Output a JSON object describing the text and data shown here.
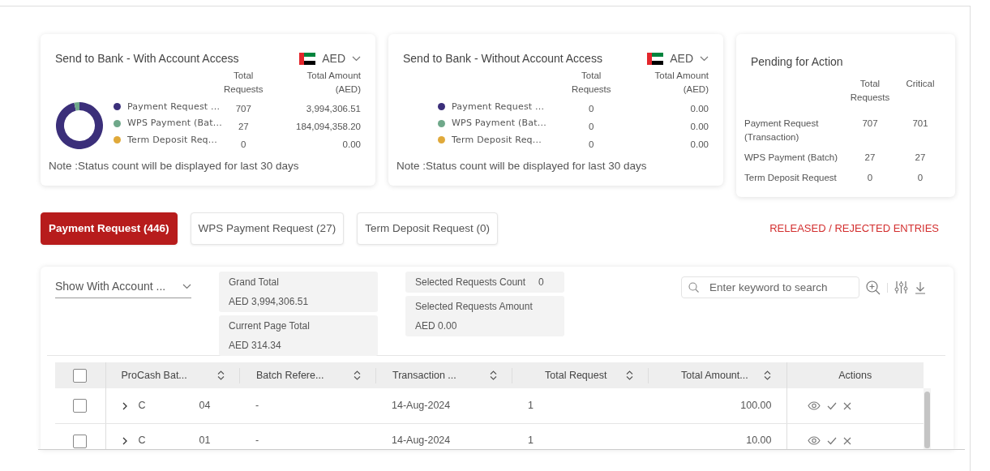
{
  "summary_cards": [
    {
      "title": "Send to Bank - With Account Access",
      "currency": "AED",
      "columns": [
        "Total Requests",
        "Total Amount (AED)"
      ],
      "rows": [
        {
          "label": "Payment Request ...",
          "color": "#3b2f7a",
          "requests": "707",
          "amount": "3,994,306.51"
        },
        {
          "label": "WPS Payment (Bat...",
          "color": "#6fa88a",
          "requests": "27",
          "amount": "184,094,358.20"
        },
        {
          "label": "Term Deposit Req...",
          "color": "#e0a93a",
          "requests": "0",
          "amount": "0.00"
        }
      ],
      "note": "Note :Status count will be displayed for last 30 days"
    },
    {
      "title": "Send to Bank - Without Account Access",
      "currency": "AED",
      "columns": [
        "Total Requests",
        "Total Amount (AED)"
      ],
      "rows": [
        {
          "label": "Payment Request ...",
          "color": "#3b2f7a",
          "requests": "0",
          "amount": "0.00"
        },
        {
          "label": "WPS Payment (Bat...",
          "color": "#6fa88a",
          "requests": "0",
          "amount": "0.00"
        },
        {
          "label": "Term Deposit Req...",
          "color": "#e0a93a",
          "requests": "0",
          "amount": "0.00"
        }
      ],
      "note": "Note :Status count will be displayed for last 30 days"
    }
  ],
  "pending": {
    "title": "Pending for Action",
    "columns": [
      "Total Requests",
      "Critical"
    ],
    "rows": [
      {
        "label": "Payment Request (Transaction)",
        "total": "707",
        "critical": "701"
      },
      {
        "label": "WPS Payment (Batch)",
        "total": "27",
        "critical": "27"
      },
      {
        "label": "Term Deposit Request",
        "total": "0",
        "critical": "0"
      }
    ]
  },
  "tabs": [
    {
      "label": "Payment Request (446)",
      "selected": true
    },
    {
      "label": "WPS Payment Request (27)",
      "selected": false
    },
    {
      "label": "Term Deposit Request (0)",
      "selected": false
    }
  ],
  "released_link": "RELEASED / REJECTED ENTRIES",
  "filter": {
    "value": "Show With Account ..."
  },
  "totals": {
    "grand_total": {
      "label": "Grand Total",
      "value": "AED 3,994,306.51"
    },
    "current_page_total": {
      "label": "Current Page Total",
      "value": "AED 314.34"
    },
    "selected_count": {
      "label": "Selected Requests Count",
      "value": "0"
    },
    "selected_amount": {
      "label": "Selected Requests Amount",
      "value": "AED 0.00"
    }
  },
  "search": {
    "placeholder": "Enter keyword to search"
  },
  "table": {
    "select_all_checked": false,
    "columns": [
      "ProCash Bat...",
      "Batch Refere...",
      "Transaction ...",
      "Total Request",
      "Total Amount...",
      "Actions"
    ],
    "rows": [
      {
        "checked": false,
        "expanded": false,
        "batch_id_start": "C",
        "batch_id_end": "04",
        "batch_reference": "-",
        "transaction_date": "14-Aug-2024",
        "total_request": "1",
        "total_amount": "100.00"
      },
      {
        "checked": false,
        "expanded": false,
        "batch_id_start": "C",
        "batch_id_end": "01",
        "batch_reference": "-",
        "transaction_date": "14-Aug-2024",
        "total_request": "1",
        "total_amount": "10.00"
      }
    ]
  }
}
